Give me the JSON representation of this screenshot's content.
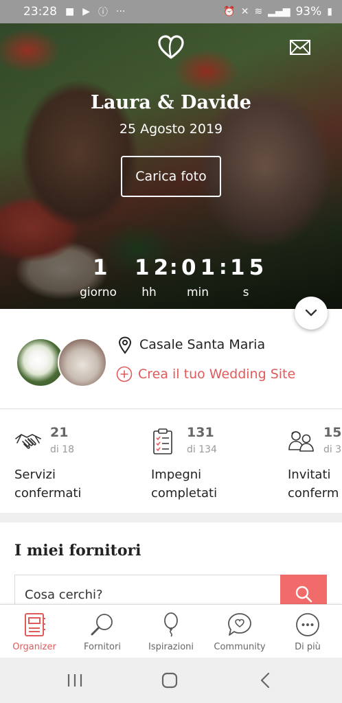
{
  "status_bar": {
    "time": "23:28",
    "battery": "93%"
  },
  "hero": {
    "names": "Laura & Davide",
    "date": "25 Agosto 2019",
    "upload_button": "Carica foto",
    "countdown": {
      "days_value": "1",
      "days_label": "giorno",
      "hours_value": "12",
      "hours_label": "hh",
      "minutes_value": "01",
      "minutes_label": "min",
      "seconds_value": "15",
      "seconds_label": "s"
    }
  },
  "profile": {
    "location": "Casale Santa Maria",
    "create_site_link": "Crea il tuo Wedding Site"
  },
  "stats": [
    {
      "icon": "handshake-icon",
      "value": "21",
      "sub": "di 18",
      "line1": "Servizi",
      "line2": "confermati"
    },
    {
      "icon": "checklist-icon",
      "value": "131",
      "sub": "di 134",
      "line1": "Impegni",
      "line2": "completati"
    },
    {
      "icon": "guests-icon",
      "value": "15",
      "sub": "di 3",
      "line1": "Invitati",
      "line2": "conferm"
    }
  ],
  "vendors": {
    "title": "I miei fornitori",
    "search_placeholder": "Cosa cerchi?"
  },
  "bottom_nav": [
    {
      "label": "Organizer",
      "icon": "notebook-icon",
      "active": true
    },
    {
      "label": "Fornitori",
      "icon": "magnifier-icon",
      "active": false
    },
    {
      "label": "Ispirazioni",
      "icon": "balloon-icon",
      "active": false
    },
    {
      "label": "Community",
      "icon": "chat-heart-icon",
      "active": false
    },
    {
      "label": "Di più",
      "icon": "more-icon",
      "active": false
    }
  ],
  "colors": {
    "accent": "#e05a5a",
    "search_button": "#f26b6b",
    "status_bar": "#9a9a9a"
  }
}
